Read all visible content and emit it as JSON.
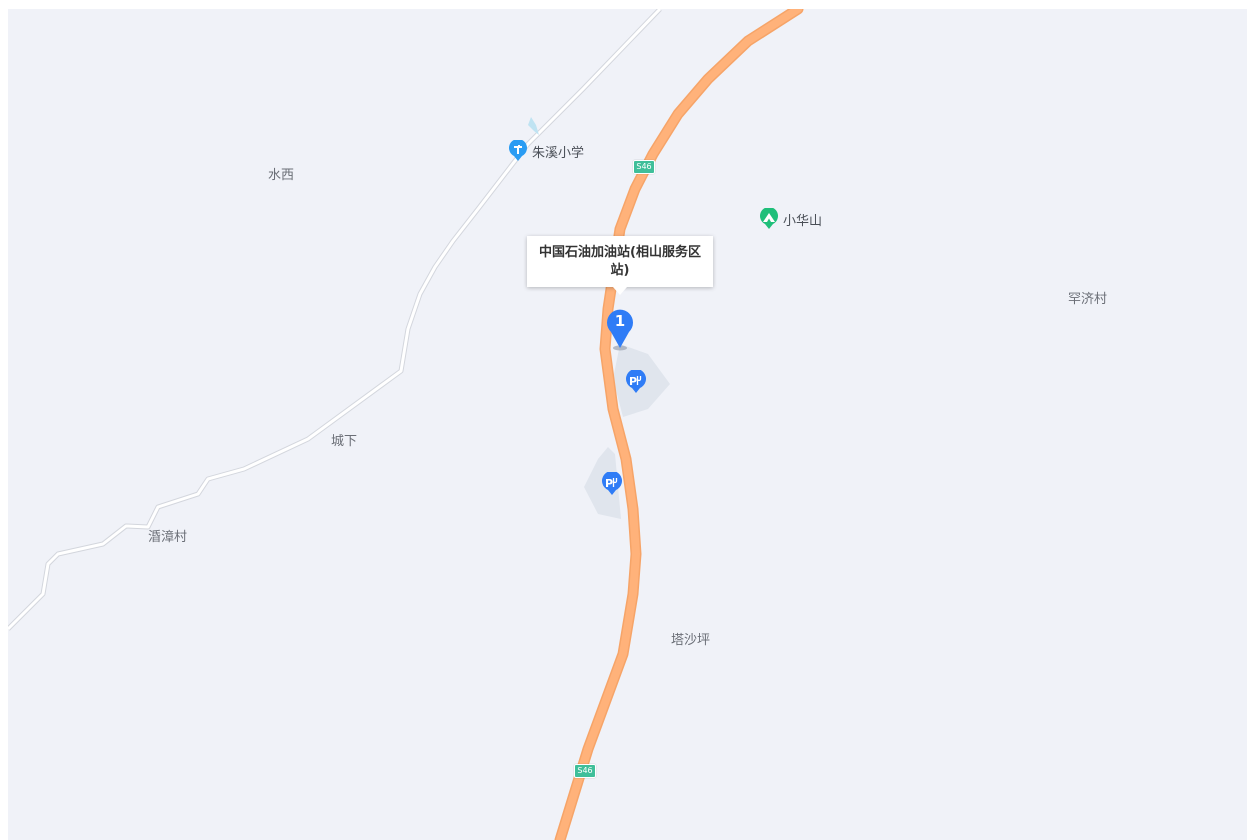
{
  "map": {
    "background_color": "#f0f2f8",
    "road_color": "#ffb27a",
    "minor_road_color": "#ffffff",
    "places": [
      {
        "id": "shuixi",
        "label": "水西"
      },
      {
        "id": "junjicun",
        "label": "罕济村"
      },
      {
        "id": "chengxia",
        "label": "城下"
      },
      {
        "id": "sizhangcun",
        "label": "涽漳村"
      },
      {
        "id": "tashaping",
        "label": "塔沙坪"
      }
    ],
    "pois": [
      {
        "id": "zhuxi-school",
        "label": "朱溪小学",
        "icon": "school-icon",
        "color": "#2a9cf3"
      },
      {
        "id": "xiaohuashan",
        "label": "小华山",
        "icon": "mountain-icon",
        "color": "#1fbf7a"
      }
    ],
    "road_shields": [
      {
        "id": "s46-north",
        "label": "S46"
      },
      {
        "id": "s46-south",
        "label": "S46"
      }
    ],
    "parking_icon": "parking-service-icon",
    "marker": {
      "number": "1",
      "color": "#2f7cf6",
      "infowindow_title": "中国石油加油站(相山服务区站)"
    }
  }
}
